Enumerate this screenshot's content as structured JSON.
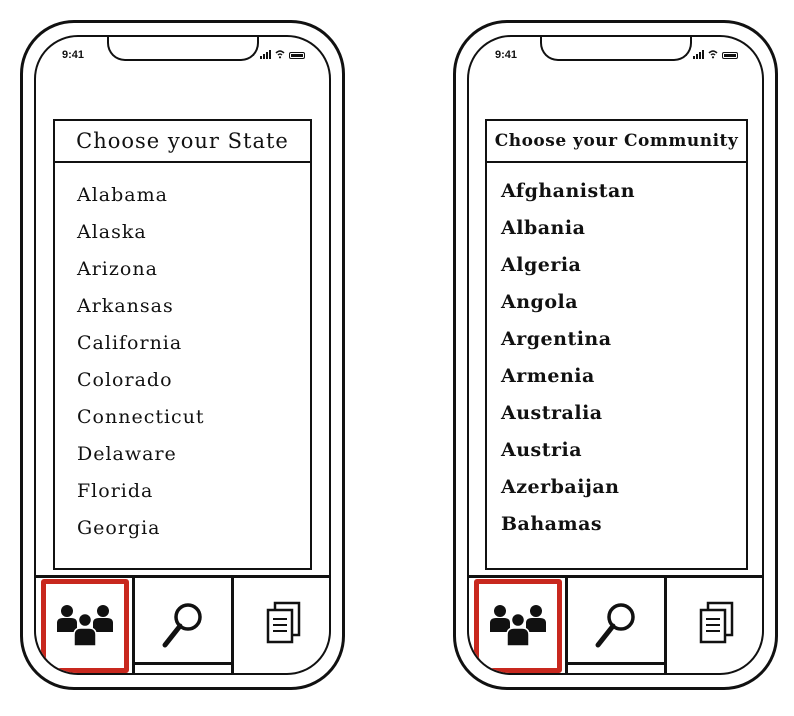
{
  "status_bar": {
    "time": "9:41"
  },
  "screens": [
    {
      "title": "Choose your State",
      "items": [
        "Alabama",
        "Alaska",
        "Arizona",
        "Arkansas",
        "California",
        "Colorado",
        "Connecticut",
        "Delaware",
        "Florida",
        "Georgia"
      ]
    },
    {
      "title": "Choose your Community",
      "items": [
        "Afghanistan",
        "Albania",
        "Algeria",
        "Angola",
        "Argentina",
        "Armenia",
        "Australia",
        "Austria",
        "Azerbaijan",
        "Bahamas"
      ]
    }
  ],
  "tabbar": {
    "tabs": [
      {
        "icon": "people-group-icon",
        "selected": true
      },
      {
        "icon": "search-icon",
        "selected": false
      },
      {
        "icon": "documents-icon",
        "selected": false
      }
    ],
    "selected_color": "#c8281e"
  }
}
